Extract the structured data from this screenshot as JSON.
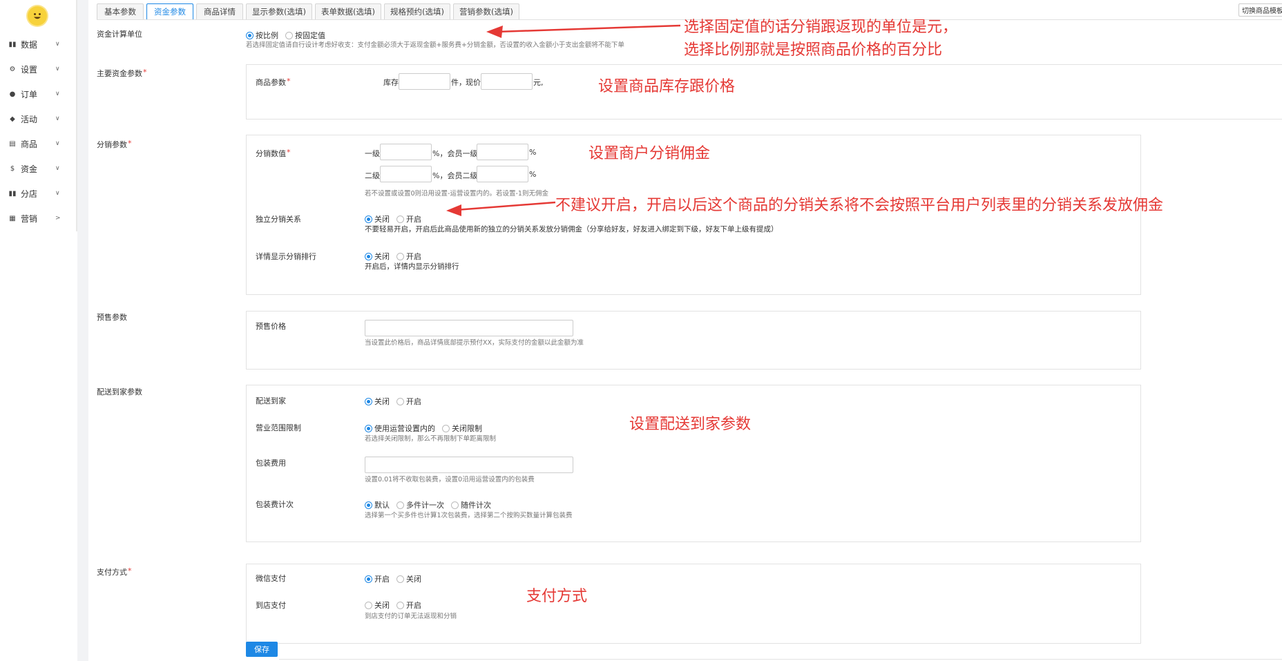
{
  "sidebar": {
    "items": [
      {
        "icon": "bar-chart-icon",
        "label": "数据",
        "arrow": "∨"
      },
      {
        "icon": "gear-icon",
        "label": "设置",
        "arrow": "∨"
      },
      {
        "icon": "info-icon",
        "label": "订单",
        "arrow": "∨"
      },
      {
        "icon": "tag-icon",
        "label": "活动",
        "arrow": "∨"
      },
      {
        "icon": "box-icon",
        "label": "商品",
        "arrow": "∨"
      },
      {
        "icon": "dollar-icon",
        "label": "资金",
        "arrow": "∨"
      },
      {
        "icon": "store-icon",
        "label": "分店",
        "arrow": "∨"
      },
      {
        "icon": "marketing-icon",
        "label": "营销",
        "arrow": ">"
      }
    ]
  },
  "tabs": [
    "基本参数",
    "资金参数",
    "商品详情",
    "显示参数(选填)",
    "表单数据(选填)",
    "规格预约(选填)",
    "营销参数(选填)"
  ],
  "switch_button": "切换商品模板",
  "form": {
    "fund_unit": {
      "label": "资金计算单位",
      "options": [
        "按比例",
        "按固定值"
      ],
      "hint": "若选择固定值请自行设计考虑好收支：支付金额必须大于返现金额+服务费+分销金额，否设置的收入金额小于支出金额将不能下单"
    },
    "main_fund": {
      "label": "主要资金参数",
      "goods_label": "商品参数",
      "stock_label": "库存",
      "stock_unit": "件，",
      "price_label": "现价",
      "price_unit": "元,"
    },
    "distribution": {
      "label": "分销参数",
      "value_label": "分销数值",
      "level1": "一级",
      "member_level1": "%，会员一级",
      "level2": "二级",
      "member_level2": "%，会员二级",
      "percent": "%",
      "value_hint": "若不设置或设置0则沿用设置-运营设置内的。若设置-1则无佣金",
      "independent_label": "独立分销关系",
      "independent_options": [
        "关闭",
        "开启"
      ],
      "independent_hint": "不要轻易开启，开启后此商品使用新的独立的分销关系发放分销佣金（分享给好友，好友进入绑定到下级，好友下单上级有提成）",
      "ranking_label": "详情显示分销排行",
      "ranking_options": [
        "关闭",
        "开启"
      ],
      "ranking_hint": "开启后，详情内显示分销排行"
    },
    "presale": {
      "label": "预售参数",
      "price_label": "预售价格",
      "hint": "当设置此价格后，商品详情底部提示预付XX，实际支付的金额以此金额为准"
    },
    "delivery": {
      "label": "配送到家参数",
      "home_label": "配送到家",
      "home_options": [
        "关闭",
        "开启"
      ],
      "range_label": "营业范围限制",
      "range_options": [
        "使用运营设置内的",
        "关闭限制"
      ],
      "range_hint": "若选择关闭限制，那么不再限制下单距离限制",
      "pack_label": "包装费用",
      "pack_hint": "设置0.01将不收取包装费，设置0沿用运营设置内的包装费",
      "packcount_label": "包装费计次",
      "packcount_options": [
        "默认",
        "多件计一次",
        "随件计次"
      ],
      "packcount_hint": "选择第一个买多件也计算1次包装费，选择第二个按购买数量计算包装费"
    },
    "payment": {
      "label": "支付方式",
      "wechat_label": "微信支付",
      "wechat_options": [
        "开启",
        "关闭"
      ],
      "store_label": "到店支付",
      "store_options": [
        "关闭",
        "开启"
      ],
      "store_hint": "到店支付的订单无法返现和分销"
    },
    "save": "保存"
  },
  "annotations": {
    "unit_line1": "选择固定值的话分销跟返现的单位是元，",
    "unit_line2": "选择比例那就是按照商品价格的百分比",
    "stock_price": "设置商品库存跟价格",
    "commission": "设置商户分销佣金",
    "independent": "不建议开启，开启以后这个商品的分销关系将不会按照平台用户列表里的分销关系发放佣金",
    "delivery": "设置配送到家参数",
    "payment": "支付方式"
  },
  "colors": {
    "accent": "#1e88e5",
    "annotation": "#e53935",
    "required": "#e53935"
  }
}
